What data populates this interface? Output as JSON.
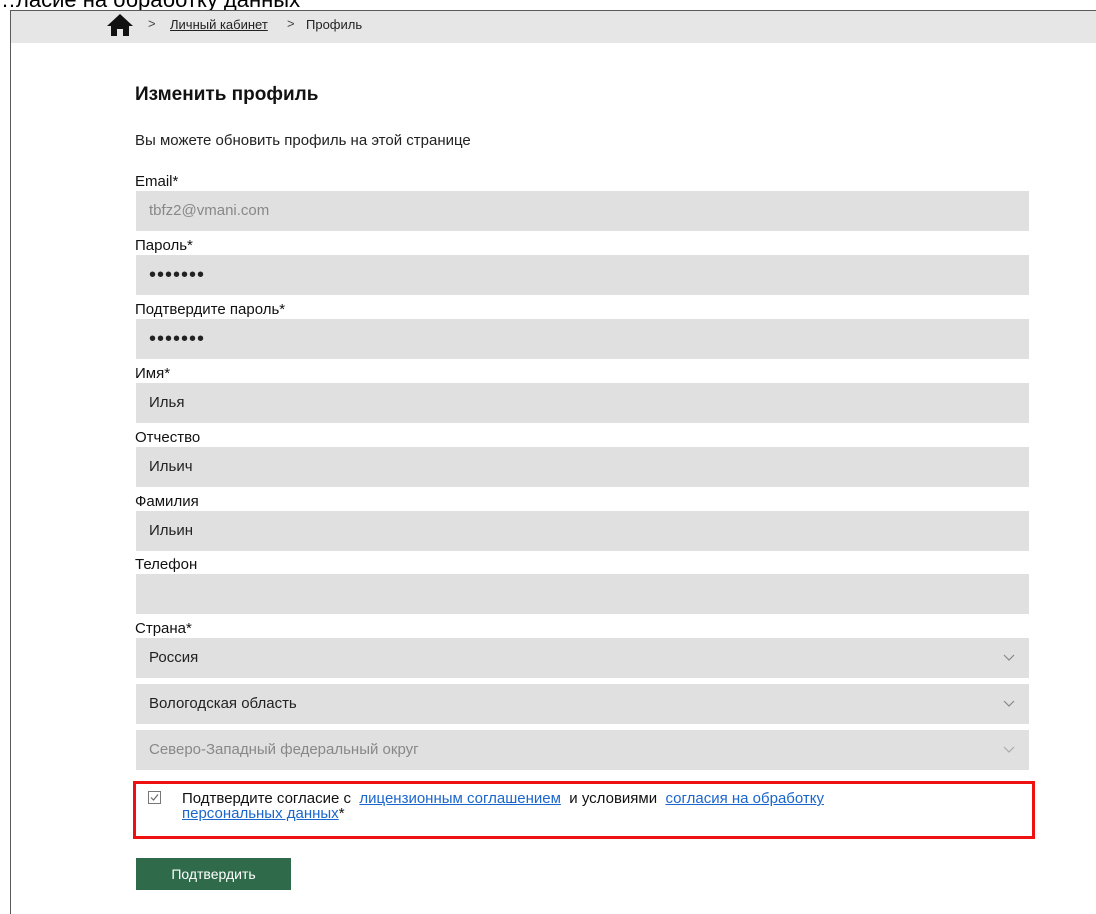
{
  "caption": "…ласие на обработку данных",
  "breadcrumb": {
    "items": [
      "Личный кабинет",
      "Профиль"
    ]
  },
  "title": "Изменить профиль",
  "subtitle": "Вы можете обновить профиль на этой странице",
  "fields": {
    "email": {
      "label": "Email*",
      "value": "tbfz2@vmani.com"
    },
    "password": {
      "label": "Пароль*",
      "value": "•••••••"
    },
    "password_confirm": {
      "label": "Подтвердите пароль*",
      "value": "•••••••"
    },
    "first_name": {
      "label": "Имя*",
      "value": "Илья"
    },
    "middle_name": {
      "label": "Отчество",
      "value": "Ильич"
    },
    "last_name": {
      "label": "Фамилия",
      "value": "Ильин"
    },
    "phone": {
      "label": "Телефон",
      "value": ""
    },
    "country": {
      "label": "Страна*",
      "value": "Россия"
    },
    "region": {
      "value": "Вологодская область"
    },
    "district": {
      "value": "Северо-Западный федеральный округ"
    }
  },
  "consent": {
    "checked": true,
    "text_before": "Подтвердите согласие с",
    "license_link": "лицензионным соглашением",
    "text_middle": "и условиями",
    "personal_link_1": "согласия на обработку",
    "personal_link_2": "персональных данных",
    "asterisk": "*"
  },
  "submit_label": "Подтвердить",
  "colors": {
    "accent": "#2f6b4a",
    "link": "#1a66cc",
    "highlight": "#ee1111",
    "field_bg": "#e0e0e0"
  }
}
